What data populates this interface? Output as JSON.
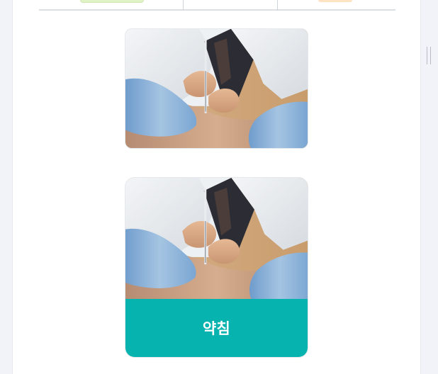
{
  "cards": [
    {
      "image": "acupuncture-injection-photo",
      "label": ""
    },
    {
      "image": "acupuncture-injection-photo",
      "label": "약침"
    }
  ],
  "colors": {
    "accent": "#06b3ae",
    "page_background": "#ffffff",
    "outer_background": "#f1f3f8"
  }
}
